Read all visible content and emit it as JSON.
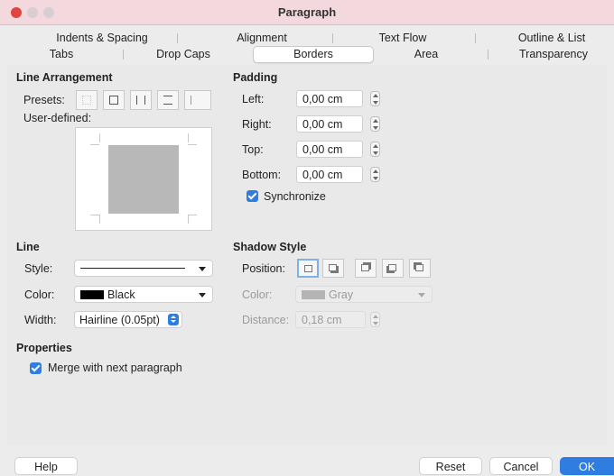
{
  "window": {
    "title": "Paragraph"
  },
  "tabs": {
    "row1": [
      "Indents & Spacing",
      "Alignment",
      "Text Flow",
      "Outline & List"
    ],
    "row2": [
      "Tabs",
      "Drop Caps",
      "Borders",
      "Area",
      "Transparency"
    ],
    "active": "Borders"
  },
  "line_arrangement": {
    "heading": "Line Arrangement",
    "presets_label": "Presets:",
    "user_defined_label": "User-defined:"
  },
  "padding": {
    "heading": "Padding",
    "left_label": "Left:",
    "left_value": "0,00 cm",
    "right_label": "Right:",
    "right_value": "0,00 cm",
    "top_label": "Top:",
    "top_value": "0,00 cm",
    "bottom_label": "Bottom:",
    "bottom_value": "0,00 cm",
    "sync_label": "Synchronize",
    "sync_checked": true
  },
  "line": {
    "heading": "Line",
    "style_label": "Style:",
    "color_label": "Color:",
    "color_value": "Black",
    "color_hex": "#000000",
    "width_label": "Width:",
    "width_value": "Hairline (0.05pt)"
  },
  "shadow": {
    "heading": "Shadow Style",
    "position_label": "Position:",
    "color_label": "Color:",
    "color_value": "Gray",
    "color_hex": "#b4b4b4",
    "distance_label": "Distance:",
    "distance_value": "0,18 cm"
  },
  "properties": {
    "heading": "Properties",
    "merge_label": "Merge with next paragraph",
    "merge_checked": true
  },
  "footer": {
    "help": "Help",
    "reset": "Reset",
    "cancel": "Cancel",
    "ok": "OK"
  },
  "colors": {
    "accent": "#2f7de1",
    "titlebar": "#f3d9de",
    "close": "#e0443e"
  }
}
